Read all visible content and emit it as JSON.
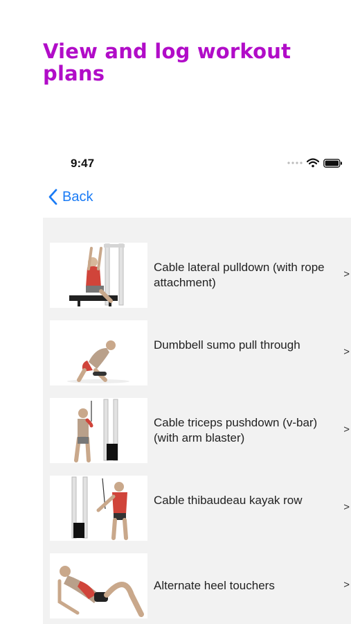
{
  "headline": "View and log workout plans",
  "status": {
    "time": "9:47"
  },
  "nav": {
    "back_label": "Back"
  },
  "exercises": [
    {
      "name": "Cable lateral pulldown (with rope attachment)",
      "chevron": ">",
      "image": "cable-pulldown-illustration"
    },
    {
      "name": "Dumbbell sumo pull through",
      "chevron": ">",
      "image": "dumbbell-sumo-illustration"
    },
    {
      "name": "Cable triceps pushdown (v-bar) (with arm blaster)",
      "chevron": ">",
      "image": "triceps-pushdown-illustration"
    },
    {
      "name": "Cable thibaudeau kayak row",
      "chevron": ">",
      "image": "kayak-row-illustration"
    },
    {
      "name": "Alternate heel touchers",
      "chevron": ">",
      "image": "heel-touchers-illustration"
    }
  ],
  "colors": {
    "headline": "#b10cc8",
    "link": "#1a7bf5",
    "list_bg": "#f2f2f2",
    "muscle": "#d0443a"
  }
}
